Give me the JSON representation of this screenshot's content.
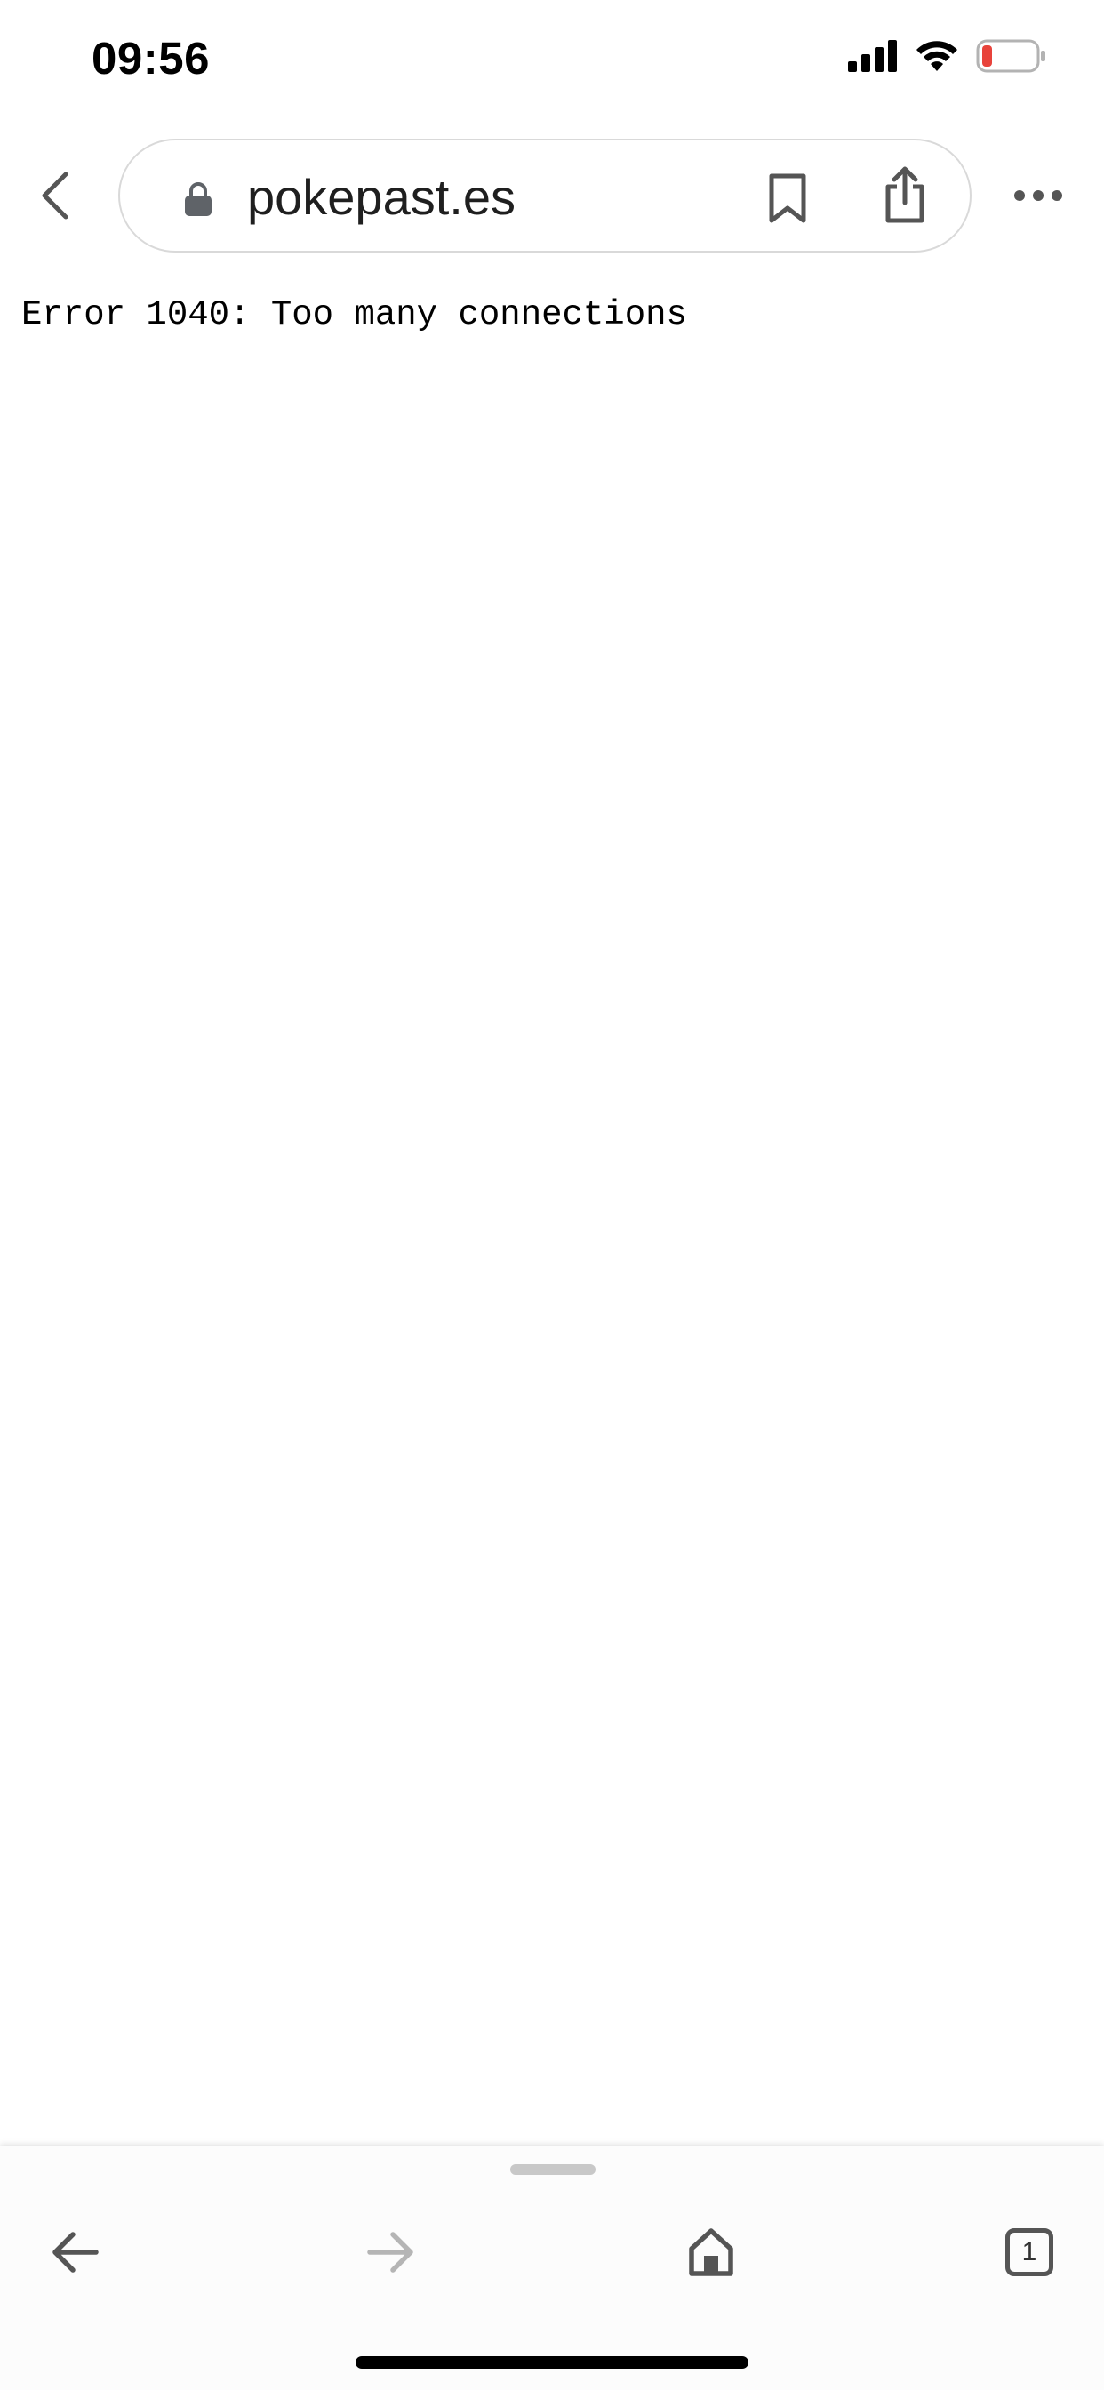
{
  "status_bar": {
    "time": "09:56",
    "icons": [
      "cellular-signal-icon",
      "wifi-icon",
      "battery-low-icon"
    ],
    "battery_color": "#e8433b"
  },
  "browser": {
    "url": "pokepast.es",
    "icons": {
      "back": "chevron-left-icon",
      "lock": "lock-icon",
      "bookmark": "bookmark-icon",
      "share": "share-icon",
      "more": "more-horizontal-icon"
    }
  },
  "page": {
    "error_message": "Error 1040: Too many connections"
  },
  "toolbar": {
    "tab_count": "1",
    "icons": [
      "arrow-left-icon",
      "arrow-right-icon",
      "home-icon",
      "tabs-icon"
    ]
  },
  "colors": {
    "icon_gray": "#555555",
    "disabled_gray": "#b5b5b5",
    "url_border": "#d9d9d9"
  }
}
